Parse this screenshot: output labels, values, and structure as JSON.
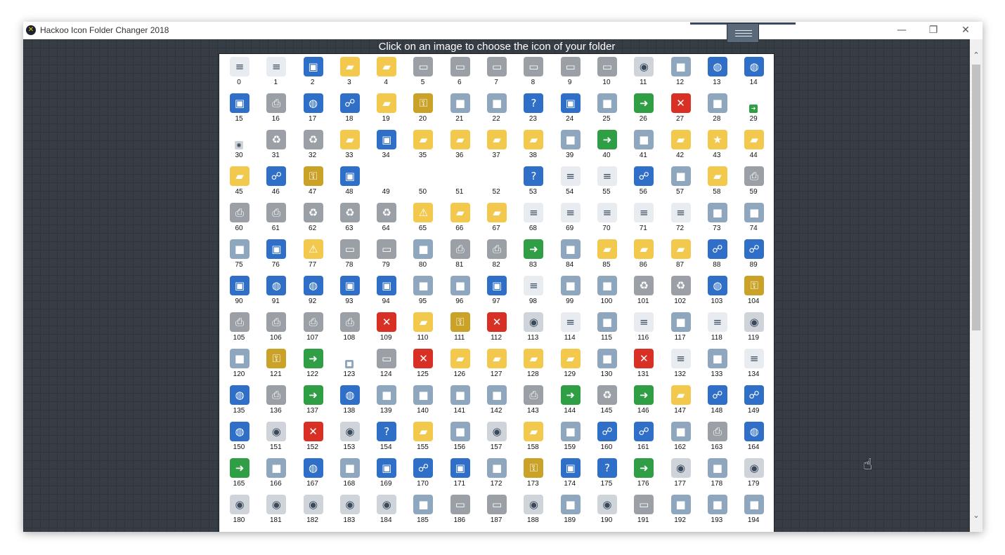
{
  "window": {
    "title": "Hackoo Icon Folder Changer 2018",
    "app_icon_glyph": "✕",
    "controls": {
      "minimize": "—",
      "maximize": "❐",
      "close": "✕"
    }
  },
  "heading": "Click on an image to choose the icon of your folder",
  "colors": {
    "background": "#373d44",
    "panel": "#ffffff",
    "folder": "#f2c94c",
    "blue": "#2f6fc8",
    "gray": "#9aa0a6",
    "green": "#2f9e44",
    "red": "#d93025"
  },
  "icon_names": [
    "document-icon",
    "text-document-icon",
    "window-icon",
    "folder-icon",
    "open-folder-icon",
    "floppy-drive-icon",
    "floppy-disk-icon",
    "drive-icon",
    "hard-drive-icon",
    "network-drive-icon",
    "disconnected-drive-icon",
    "cd-drive-icon",
    "memory-chip-icon",
    "globe-icon",
    "globe-mouse-icon",
    "monitor-icon",
    "printer-icon",
    "network-globe-icon",
    "network-icon",
    "programs-folder-icon",
    "clock-icon",
    "control-panel-icon",
    "search-icon",
    "help-icon",
    "window-run-icon",
    "shutdown-dialog-icon",
    "arrow-right-icon",
    "power-icon",
    "handshake-icon",
    "shortcut-arrow-icon",
    "small-cd-icon",
    "recycle-bin-empty-icon",
    "recycle-bin-full-icon",
    "shared-folder-icon",
    "desktop-icon",
    "tools-folder-icon",
    "applications-folder-icon",
    "printers-folder-icon",
    "fonts-folder-icon",
    "taskbar-settings-icon",
    "display-icon",
    "tree-icon",
    "computer-folder-icon",
    "favorites-star-icon",
    "key-folder-icon",
    "upload-folder-icon",
    "network-refresh-icon",
    "lock-icon",
    "window-settings-icon",
    "blank-icon",
    "blank-icon",
    "blank-icon",
    "blank-icon",
    "server-help-icon",
    "copy-documents-icon",
    "find-document-icon",
    "network-search-icon",
    "settings-panel-icon",
    "folder-documents-icon",
    "add-printer-icon",
    "fax-icon",
    "printer-save-icon",
    "recycle-bin-icon",
    "recycle-bin-icon",
    "recycle-bin-icon",
    "warning-document-icon",
    "warning-folder-icon",
    "folder-open-icon",
    "document-move-icon",
    "gear-document-icon",
    "blank-document-icon",
    "settings-document-icon",
    "gear-file-icon",
    "font-a-icon",
    "font-t-icon",
    "font-a-italic-icon",
    "window-run-icon",
    "warning-icon",
    "drive-paint-icon",
    "drive-icon",
    "boxes-icon",
    "printer-check-icon",
    "printer-default-icon",
    "floppy-check-icon",
    "diagram-icon",
    "folder-sync-icon",
    "favorites-folder-icon",
    "folder-move-icon",
    "network-computers-icon",
    "network-monitors-icon",
    "window-gear-icon",
    "globe-frame-icon",
    "computer-globe-icon",
    "window-list-icon",
    "monitor-blue-icon",
    "table-grid-icon",
    "color-grid-icon",
    "window-image-icon",
    "documents-icon",
    "hand-cursor-icon",
    "pointer-cursor-icon",
    "recycle-icon",
    "recycle-full-icon",
    "shared-globe-icon",
    "keys-icon",
    "scanner-icon",
    "printer-ok-icon",
    "printer-network-icon",
    "printer-remove-icon",
    "stop-icon",
    "checklist-folder-icon",
    "user-key-icon",
    "power-button-icon",
    "dvd-icon",
    "documents-stack-icon",
    "film-icon",
    "music-document-icon",
    "camera-icon",
    "photo-document-icon",
    "cd-music-icon",
    "mouse-icon",
    "keyboard-icon",
    "download-arrow-icon",
    "small-download-icon",
    "drive-flat-icon",
    "deleted-list-icon",
    "folder-tall-icon",
    "movie-folder-icon",
    "music-folder-icon",
    "video-folder-icon",
    "butterfly-icon",
    "delete-x-icon",
    "document-export-icon",
    "screen-resize-icon",
    "text-file-icon",
    "globe-arrow-icon",
    "printer-flat-icon",
    "play-icon",
    "globe-network-icon",
    "camera-scan-icon",
    "projector-screen-icon",
    "paint-brush-icon",
    "image-frame-icon",
    "printer-fax-icon",
    "checkmark-icon",
    "recycle-empty-icon",
    "up-arrow-icon",
    "warning-folder-small-icon",
    "network-share-icon",
    "add-network-icon",
    "home-globe-icon",
    "cd-red-icon",
    "document-delete-icon",
    "cd-search-icon",
    "help-blue-icon",
    "folder-plain-icon",
    "envelope-icon",
    "cd-red-small-icon",
    "users-folder-icon",
    "fullscreen-icon",
    "users-icon",
    "network-map-icon",
    "server-doc-icon",
    "printer-gear-icon",
    "network-globe-small-icon",
    "checklist-icon",
    "pie-chart-icon",
    "clock-globe-icon",
    "speakers-icon",
    "gear-window-icon",
    "user-group-icon",
    "search-window-icon",
    "chat-bubble-icon",
    "keyboard-monitor-icon",
    "monitor-contrast-icon",
    "help-window-icon",
    "arrow-green-icon",
    "dvd-drive-icon",
    "music-add-icon",
    "help-cd-icon",
    "cd-rom-icon",
    "cd-r-icon",
    "cd-rw-icon",
    "dvd-ram-icon",
    "dvd-r-icon",
    "usb-stick-icon",
    "hdd-case-icon",
    "drive-slot-icon",
    "cd-blank-icon",
    "memory-card-icon",
    "dvd-rom-icon",
    "drive-small-icon",
    "sd-card-icon",
    "memory-stick-icon",
    "smart-card-icon"
  ],
  "icons": [
    "0",
    "1",
    "2",
    "3",
    "4",
    "5",
    "6",
    "7",
    "8",
    "9",
    "10",
    "11",
    "12",
    "13",
    "14",
    "15",
    "16",
    "17",
    "18",
    "19",
    "20",
    "21",
    "22",
    "23",
    "24",
    "25",
    "26",
    "27",
    "28",
    "29",
    "30",
    "31",
    "32",
    "33",
    "34",
    "35",
    "36",
    "37",
    "38",
    "39",
    "40",
    "41",
    "42",
    "43",
    "44",
    "45",
    "46",
    "47",
    "48",
    "49",
    "50",
    "51",
    "52",
    "53",
    "54",
    "55",
    "56",
    "57",
    "58",
    "59",
    "60",
    "61",
    "62",
    "63",
    "64",
    "65",
    "66",
    "67",
    "68",
    "69",
    "70",
    "71",
    "72",
    "73",
    "74",
    "75",
    "76",
    "77",
    "78",
    "79",
    "80",
    "81",
    "82",
    "83",
    "84",
    "85",
    "86",
    "87",
    "88",
    "89",
    "90",
    "91",
    "92",
    "93",
    "94",
    "95",
    "96",
    "97",
    "98",
    "99",
    "100",
    "101",
    "102",
    "103",
    "104",
    "105",
    "106",
    "107",
    "108",
    "109",
    "110",
    "111",
    "112",
    "113",
    "114",
    "115",
    "116",
    "117",
    "118",
    "119",
    "120",
    "121",
    "122",
    "123",
    "124",
    "125",
    "126",
    "127",
    "128",
    "129",
    "130",
    "131",
    "132",
    "133",
    "134",
    "135",
    "136",
    "137",
    "138",
    "139",
    "140",
    "141",
    "142",
    "143",
    "144",
    "145",
    "146",
    "147",
    "148",
    "149",
    "150",
    "151",
    "152",
    "153",
    "154",
    "155",
    "156",
    "157",
    "158",
    "159",
    "160",
    "161",
    "162",
    "163",
    "164",
    "165",
    "166",
    "167",
    "168",
    "169",
    "170",
    "171",
    "172",
    "173",
    "174",
    "175",
    "176",
    "177",
    "178",
    "179",
    "180",
    "181",
    "182",
    "183",
    "184",
    "185",
    "186",
    "187",
    "188",
    "189",
    "190",
    "191",
    "192",
    "193",
    "194"
  ],
  "scrollbar": {
    "up": "⌃",
    "down": "⌄",
    "position_fraction": 0.0
  }
}
